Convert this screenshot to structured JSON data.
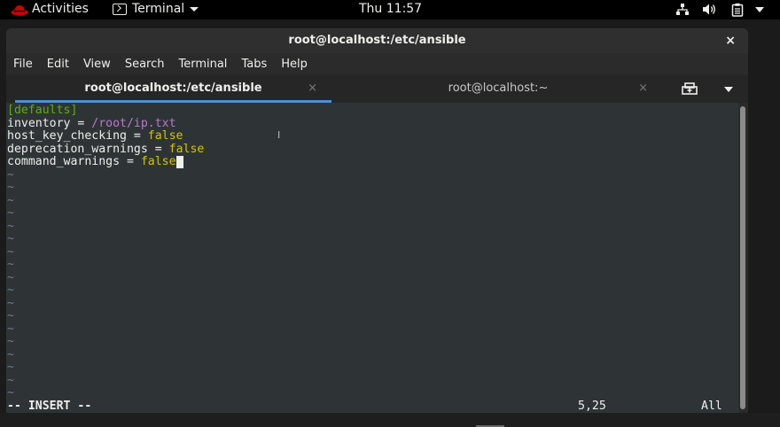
{
  "topbar": {
    "activities": "Activities",
    "app_name": "Terminal",
    "clock": "Thu 11:57",
    "icons": [
      "redhat-logo-icon",
      "terminal-icon",
      "network-icon",
      "volume-icon",
      "clipboard-icon",
      "power-menu-icon"
    ]
  },
  "window": {
    "title": "root@localhost:/etc/ansible",
    "close_symbol": "×"
  },
  "menu": [
    "File",
    "Edit",
    "View",
    "Search",
    "Terminal",
    "Tabs",
    "Help"
  ],
  "tabs": [
    {
      "label": "root@localhost:/etc/ansible",
      "close": "×",
      "active": true
    },
    {
      "label": "root@localhost:~",
      "close": "×",
      "active": false
    }
  ],
  "editor": {
    "lines": [
      [
        {
          "text": "[defaults]",
          "cls": "c-green"
        }
      ],
      [
        {
          "text": "inventory = ",
          "cls": ""
        },
        {
          "text": "/root/ip.txt",
          "cls": "c-magenta"
        }
      ],
      [
        {
          "text": "host_key_checking = ",
          "cls": ""
        },
        {
          "text": "false",
          "cls": "c-yellow"
        }
      ],
      [
        {
          "text": "deprecation_warnings = ",
          "cls": ""
        },
        {
          "text": "false",
          "cls": "c-yellow"
        }
      ],
      [
        {
          "text": "command_warnings = ",
          "cls": ""
        },
        {
          "text": "false",
          "cls": "c-yellow"
        }
      ]
    ],
    "cursor_line": 4,
    "tilde": "~",
    "tilde_count": 18,
    "mode": "-- INSERT --",
    "position": "5,25",
    "scope": "All",
    "pointer": "I"
  },
  "colors": {
    "terminal_bg": "#2e3436",
    "section": "#5fb000",
    "path": "#b87acb",
    "keyword": "#d3c400",
    "tab_indicator": "#4a90d9"
  }
}
